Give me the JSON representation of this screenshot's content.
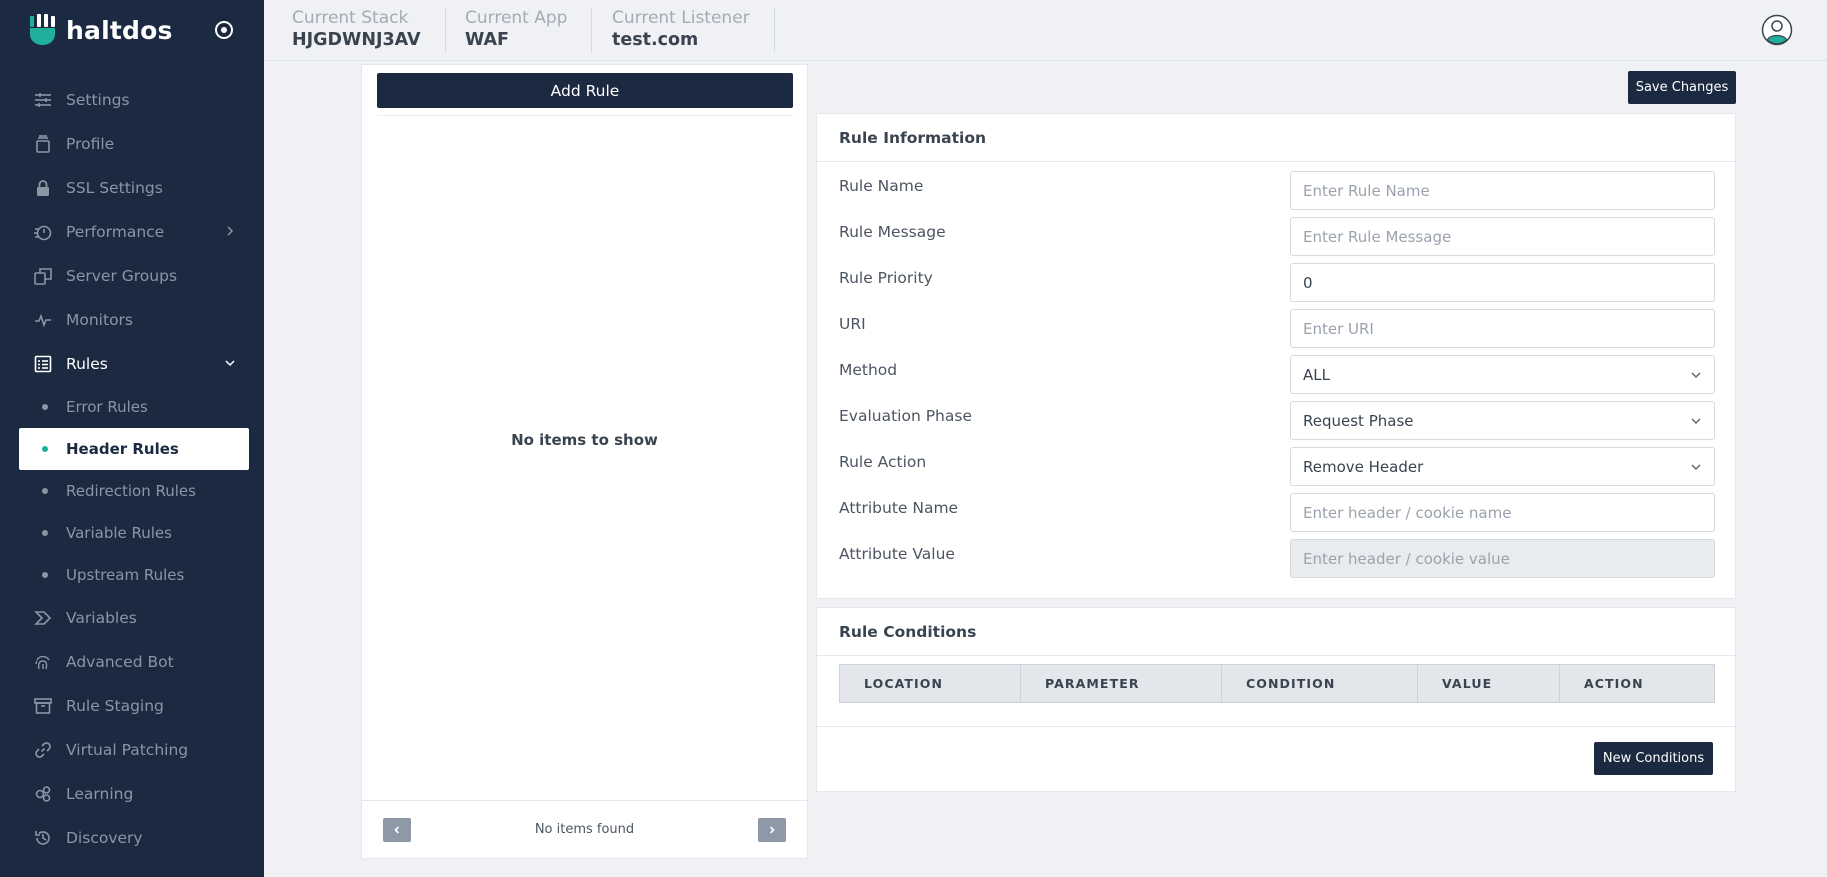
{
  "brand": {
    "name": "haltdos"
  },
  "sidebar": {
    "items": [
      {
        "label": "Settings",
        "icon": "sliders-icon"
      },
      {
        "label": "Profile",
        "icon": "profile-icon"
      },
      {
        "label": "SSL Settings",
        "icon": "lock-icon"
      },
      {
        "label": "Performance",
        "icon": "stopwatch-icon"
      },
      {
        "label": "Server Groups",
        "icon": "copy-icon"
      },
      {
        "label": "Monitors",
        "icon": "pulse-icon"
      },
      {
        "label": "Rules",
        "icon": "list-icon"
      }
    ],
    "rules_sub": [
      {
        "label": "Error Rules"
      },
      {
        "label": "Header Rules"
      },
      {
        "label": "Redirection Rules"
      },
      {
        "label": "Variable Rules"
      },
      {
        "label": "Upstream Rules"
      }
    ],
    "items_after": [
      {
        "label": "Variables",
        "icon": "variable-icon"
      },
      {
        "label": "Advanced Bot",
        "icon": "fingerprint-icon"
      },
      {
        "label": "Rule Staging",
        "icon": "archive-icon"
      },
      {
        "label": "Virtual Patching",
        "icon": "link-icon"
      },
      {
        "label": "Learning",
        "icon": "learning-icon"
      },
      {
        "label": "Discovery",
        "icon": "history-icon"
      }
    ]
  },
  "header": {
    "stack_label": "Current Stack",
    "stack_value": "HJGDWNJ3AV",
    "app_label": "Current App",
    "app_value": "WAF",
    "listener_label": "Current Listener",
    "listener_value": "test.com"
  },
  "rule_list": {
    "add_label": "Add Rule",
    "empty_text": "No items to show",
    "footer_text": "No items found"
  },
  "save_label": "Save Changes",
  "rule_info": {
    "title": "Rule Information",
    "fields": [
      {
        "label": "Rule Name",
        "value": "",
        "placeholder": "Enter Rule Name"
      },
      {
        "label": "Rule Message",
        "value": "",
        "placeholder": "Enter Rule Message"
      },
      {
        "label": "Rule Priority",
        "value": "0",
        "placeholder": ""
      },
      {
        "label": "URI",
        "value": "",
        "placeholder": "Enter URI"
      },
      {
        "label": "Method",
        "value": "ALL"
      },
      {
        "label": "Evaluation Phase",
        "value": "Request Phase"
      },
      {
        "label": "Rule Action",
        "value": "Remove Header"
      },
      {
        "label": "Attribute Name",
        "value": "",
        "placeholder": "Enter header / cookie name"
      },
      {
        "label": "Attribute Value",
        "value": "",
        "placeholder": "Enter header / cookie value"
      }
    ]
  },
  "rule_conditions": {
    "title": "Rule Conditions",
    "columns": [
      "LOCATION",
      "PARAMETER",
      "CONDITION",
      "VALUE",
      "ACTION"
    ],
    "new_label": "New Conditions"
  },
  "colors": {
    "sidebar_bg": "#1b2a40",
    "accent": "#1faf9a",
    "button_bg": "#1b2a40"
  }
}
